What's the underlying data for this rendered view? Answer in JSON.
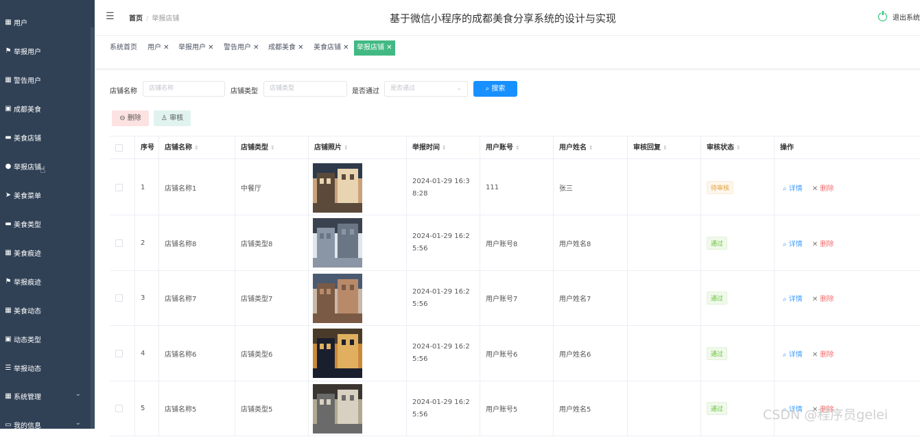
{
  "sidebar": {
    "items": [
      {
        "label": "用户",
        "icon": "grid-icon"
      },
      {
        "label": "举报用户",
        "icon": "flag-icon"
      },
      {
        "label": "警告用户",
        "icon": "grid-icon"
      },
      {
        "label": "成都美食",
        "icon": "clipboard-icon"
      },
      {
        "label": "美食店铺",
        "icon": "monitor-icon"
      },
      {
        "label": "举报店铺",
        "icon": "user-icon"
      },
      {
        "label": "美食菜单",
        "icon": "send-icon"
      },
      {
        "label": "美食类型",
        "icon": "monitor-icon"
      },
      {
        "label": "美食痕迹",
        "icon": "grid-icon"
      },
      {
        "label": "举报痕迹",
        "icon": "flag-icon"
      },
      {
        "label": "美食动态",
        "icon": "grid-icon"
      },
      {
        "label": "动态类型",
        "icon": "clipboard-icon"
      },
      {
        "label": "举报动态",
        "icon": "list-icon"
      },
      {
        "label": "系统管理",
        "icon": "grid-icon"
      },
      {
        "label": "我的信息",
        "icon": "doc-icon"
      }
    ]
  },
  "header": {
    "breadcrumb_home": "首页",
    "breadcrumb_sep": "/",
    "breadcrumb_current": "举报店铺",
    "title": "基于微信小程序的成都美食分享系统的设计与实现",
    "logout": "退出系统"
  },
  "tags": [
    {
      "label": "系统首页"
    },
    {
      "label": "用户 ✕"
    },
    {
      "label": "举报用户 ✕"
    },
    {
      "label": "警告用户 ✕"
    },
    {
      "label": "成都美食 ✕"
    },
    {
      "label": "美食店铺 ✕"
    },
    {
      "label": "举报店铺 ✕"
    }
  ],
  "filters": {
    "shop_name_label": "店铺名称",
    "shop_name_placeholder": "店铺名称",
    "shop_type_label": "店铺类型",
    "shop_type_placeholder": "店铺类型",
    "passed_label": "是否通过",
    "passed_placeholder": "是否通过",
    "search_button": "搜索"
  },
  "actions": {
    "delete": "删除",
    "audit": "审核"
  },
  "table": {
    "headers": [
      "序号",
      "店铺名称",
      "店铺类型",
      "店铺照片",
      "举报时间",
      "用户账号",
      "用户姓名",
      "审核回复",
      "审核状态",
      "操作"
    ],
    "detail_label": "详情",
    "delete_label": "删除",
    "rows": [
      {
        "index": "1",
        "name": "店铺名称1",
        "type": "中餐厅",
        "time": "2024-01-29 16:38:28",
        "account": "111",
        "username": "张三",
        "reply": "",
        "status": "待审核",
        "status_kind": "pending"
      },
      {
        "index": "2",
        "name": "店铺名称8",
        "type": "店铺类型8",
        "time": "2024-01-29 16:25:56",
        "account": "用户账号8",
        "username": "用户姓名8",
        "reply": "",
        "status": "通过",
        "status_kind": "pass"
      },
      {
        "index": "3",
        "name": "店铺名称7",
        "type": "店铺类型7",
        "time": "2024-01-29 16:25:56",
        "account": "用户账号7",
        "username": "用户姓名7",
        "reply": "",
        "status": "通过",
        "status_kind": "pass"
      },
      {
        "index": "4",
        "name": "店铺名称6",
        "type": "店铺类型6",
        "time": "2024-01-29 16:25:56",
        "account": "用户账号6",
        "username": "用户姓名6",
        "reply": "",
        "status": "通过",
        "status_kind": "pass"
      },
      {
        "index": "5",
        "name": "店铺名称5",
        "type": "店铺类型5",
        "time": "2024-01-29 16:25:56",
        "account": "用户账号5",
        "username": "用户姓名5",
        "reply": "",
        "status": "通过",
        "status_kind": "pass"
      }
    ]
  },
  "watermark": "CSDN @程序员gelei",
  "colors": {
    "sidebar_bg": "#304156",
    "active_tag": "#42b983",
    "primary": "#1890ff",
    "danger": "#f56c6c"
  }
}
